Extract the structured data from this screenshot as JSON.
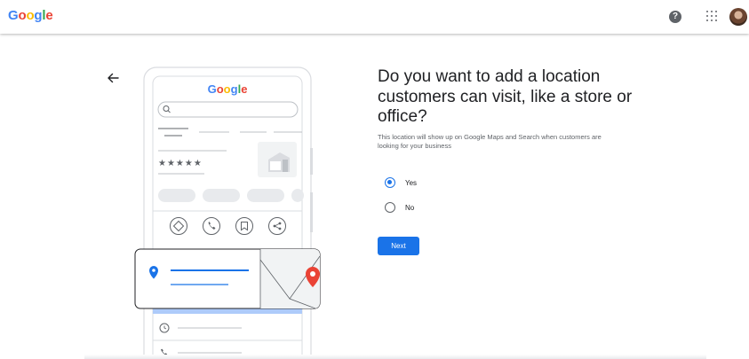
{
  "header": {
    "logo_letters": [
      {
        "char": "G",
        "color": "#4285F4"
      },
      {
        "char": "o",
        "color": "#EA4335"
      },
      {
        "char": "o",
        "color": "#FBBC05"
      },
      {
        "char": "g",
        "color": "#4285F4"
      },
      {
        "char": "l",
        "color": "#34A853"
      },
      {
        "char": "e",
        "color": "#EA4335"
      }
    ],
    "help_icon": "help-circle-icon",
    "help_glyph": "?",
    "apps_icon": "apps-grid-icon",
    "avatar_icon": "user-avatar"
  },
  "nav": {
    "back_icon": "arrow-left-icon"
  },
  "illustration": {
    "phone_logo": "Google",
    "rating_stars": "★★★★★",
    "colors": {
      "blue": "#1a73e8",
      "red": "#ea4335",
      "gray": "#dadce0",
      "light_blue": "#aecbfa"
    }
  },
  "main": {
    "question": "Do you want to add a location customers can visit, like a store or office?",
    "description": "This location will show up on Google Maps and Search when customers are looking for your business",
    "options": [
      {
        "label": "Yes",
        "checked": true
      },
      {
        "label": "No",
        "checked": false
      }
    ],
    "next_label": "Next"
  },
  "colors": {
    "accent": "#1a73e8",
    "text": "#202124",
    "secondary_text": "#5f6368"
  }
}
